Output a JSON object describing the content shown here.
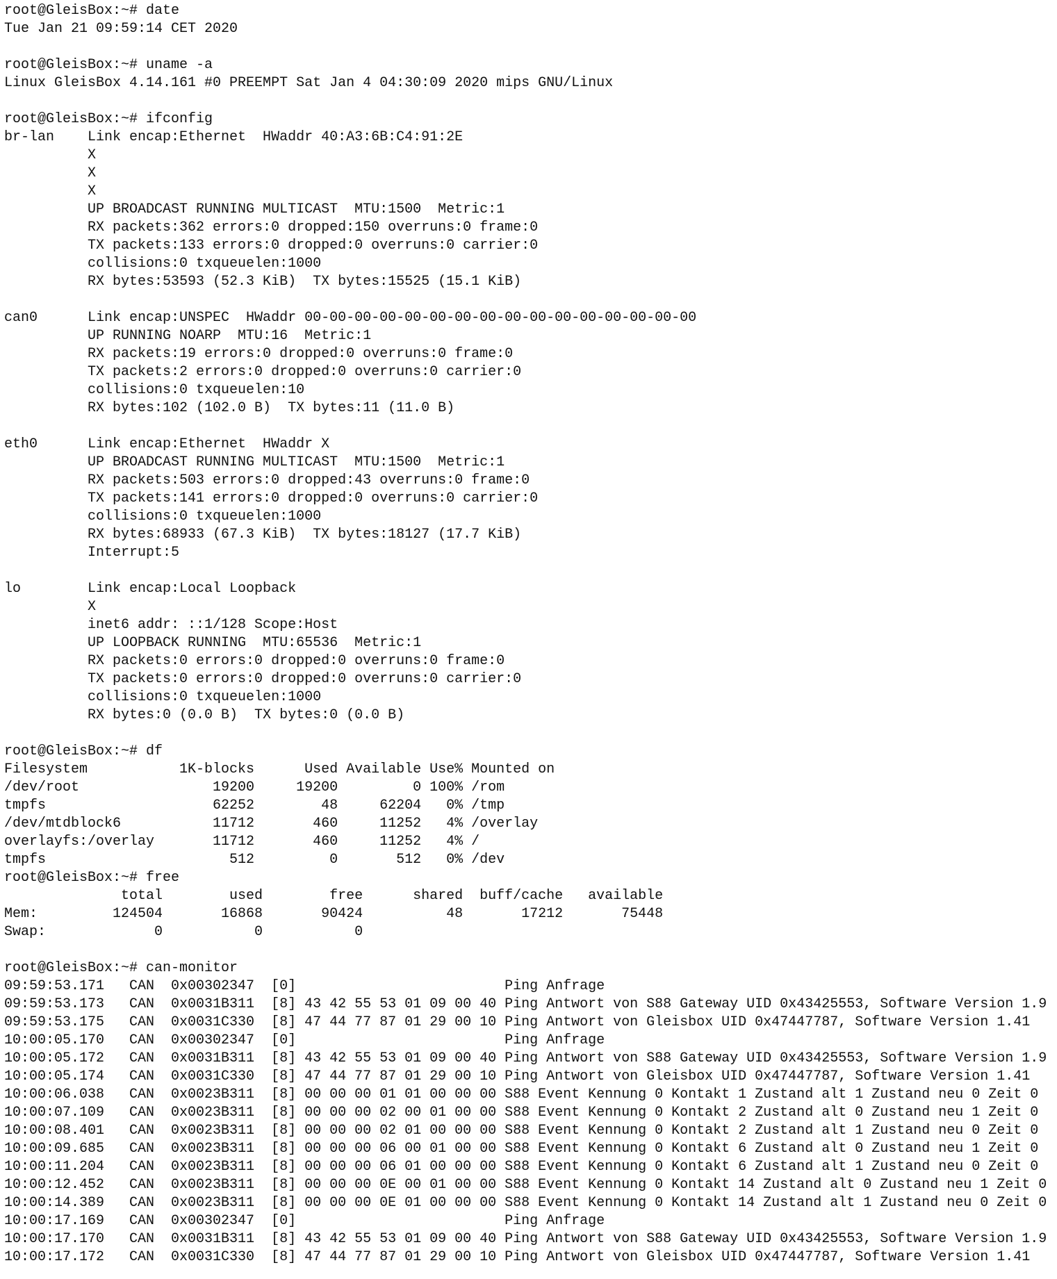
{
  "terminal": {
    "sessions": [
      {
        "prompt": "root@GleisBox:~# date",
        "output": [
          "Tue Jan 21 09:59:14 CET 2020",
          ""
        ]
      },
      {
        "prompt": "root@GleisBox:~# uname -a",
        "output": [
          "Linux GleisBox 4.14.161 #0 PREEMPT Sat Jan 4 04:30:09 2020 mips GNU/Linux",
          ""
        ]
      },
      {
        "prompt": "root@GleisBox:~# ifconfig",
        "output": [
          "br-lan    Link encap:Ethernet  HWaddr 40:A3:6B:C4:91:2E",
          "          X",
          "          X",
          "          X",
          "          UP BROADCAST RUNNING MULTICAST  MTU:1500  Metric:1",
          "          RX packets:362 errors:0 dropped:150 overruns:0 frame:0",
          "          TX packets:133 errors:0 dropped:0 overruns:0 carrier:0",
          "          collisions:0 txqueuelen:1000",
          "          RX bytes:53593 (52.3 KiB)  TX bytes:15525 (15.1 KiB)",
          "",
          "can0      Link encap:UNSPEC  HWaddr 00-00-00-00-00-00-00-00-00-00-00-00-00-00-00-00",
          "          UP RUNNING NOARP  MTU:16  Metric:1",
          "          RX packets:19 errors:0 dropped:0 overruns:0 frame:0",
          "          TX packets:2 errors:0 dropped:0 overruns:0 carrier:0",
          "          collisions:0 txqueuelen:10",
          "          RX bytes:102 (102.0 B)  TX bytes:11 (11.0 B)",
          "",
          "eth0      Link encap:Ethernet  HWaddr X",
          "          UP BROADCAST RUNNING MULTICAST  MTU:1500  Metric:1",
          "          RX packets:503 errors:0 dropped:43 overruns:0 frame:0",
          "          TX packets:141 errors:0 dropped:0 overruns:0 carrier:0",
          "          collisions:0 txqueuelen:1000",
          "          RX bytes:68933 (67.3 KiB)  TX bytes:18127 (17.7 KiB)",
          "          Interrupt:5",
          "",
          "lo        Link encap:Local Loopback",
          "          X",
          "          inet6 addr: ::1/128 Scope:Host",
          "          UP LOOPBACK RUNNING  MTU:65536  Metric:1",
          "          RX packets:0 errors:0 dropped:0 overruns:0 frame:0",
          "          TX packets:0 errors:0 dropped:0 overruns:0 carrier:0",
          "          collisions:0 txqueuelen:1000",
          "          RX bytes:0 (0.0 B)  TX bytes:0 (0.0 B)",
          ""
        ]
      },
      {
        "prompt": "root@GleisBox:~# df",
        "output": [
          "Filesystem           1K-blocks      Used Available Use% Mounted on",
          "/dev/root                19200     19200         0 100% /rom",
          "tmpfs                    62252        48     62204   0% /tmp",
          "/dev/mtdblock6           11712       460     11252   4% /overlay",
          "overlayfs:/overlay       11712       460     11252   4% /",
          "tmpfs                      512         0       512   0% /dev"
        ]
      },
      {
        "prompt": "root@GleisBox:~# free",
        "output": [
          "              total        used        free      shared  buff/cache   available",
          "Mem:         124504       16868       90424          48       17212       75448",
          "Swap:             0           0           0",
          ""
        ]
      },
      {
        "prompt": "root@GleisBox:~# can-monitor",
        "output": [
          "09:59:53.171   CAN  0x00302347  [0]                         Ping Anfrage",
          "09:59:53.173   CAN  0x0031B311  [8] 43 42 55 53 01 09 00 40 Ping Antwort von S88 Gateway UID 0x43425553, Software Version 1.9",
          "09:59:53.175   CAN  0x0031C330  [8] 47 44 77 87 01 29 00 10 Ping Antwort von Gleisbox UID 0x47447787, Software Version 1.41",
          "10:00:05.170   CAN  0x00302347  [0]                         Ping Anfrage",
          "10:00:05.172   CAN  0x0031B311  [8] 43 42 55 53 01 09 00 40 Ping Antwort von S88 Gateway UID 0x43425553, Software Version 1.9",
          "10:00:05.174   CAN  0x0031C330  [8] 47 44 77 87 01 29 00 10 Ping Antwort von Gleisbox UID 0x47447787, Software Version 1.41",
          "10:00:06.038   CAN  0x0023B311  [8] 00 00 00 01 01 00 00 00 S88 Event Kennung 0 Kontakt 1 Zustand alt 1 Zustand neu 0 Zeit 0",
          "10:00:07.109   CAN  0x0023B311  [8] 00 00 00 02 00 01 00 00 S88 Event Kennung 0 Kontakt 2 Zustand alt 0 Zustand neu 1 Zeit 0",
          "10:00:08.401   CAN  0x0023B311  [8] 00 00 00 02 01 00 00 00 S88 Event Kennung 0 Kontakt 2 Zustand alt 1 Zustand neu 0 Zeit 0",
          "10:00:09.685   CAN  0x0023B311  [8] 00 00 00 06 00 01 00 00 S88 Event Kennung 0 Kontakt 6 Zustand alt 0 Zustand neu 1 Zeit 0",
          "10:00:11.204   CAN  0x0023B311  [8] 00 00 00 06 01 00 00 00 S88 Event Kennung 0 Kontakt 6 Zustand alt 1 Zustand neu 0 Zeit 0",
          "10:00:12.452   CAN  0x0023B311  [8] 00 00 00 0E 00 01 00 00 S88 Event Kennung 0 Kontakt 14 Zustand alt 0 Zustand neu 1 Zeit 0",
          "10:00:14.389   CAN  0x0023B311  [8] 00 00 00 0E 01 00 00 00 S88 Event Kennung 0 Kontakt 14 Zustand alt 1 Zustand neu 0 Zeit 0",
          "10:00:17.169   CAN  0x00302347  [0]                         Ping Anfrage",
          "10:00:17.170   CAN  0x0031B311  [8] 43 42 55 53 01 09 00 40 Ping Antwort von S88 Gateway UID 0x43425553, Software Version 1.9",
          "10:00:17.172   CAN  0x0031C330  [8] 47 44 77 87 01 29 00 10 Ping Antwort von Gleisbox UID 0x47447787, Software Version 1.41"
        ]
      }
    ]
  }
}
